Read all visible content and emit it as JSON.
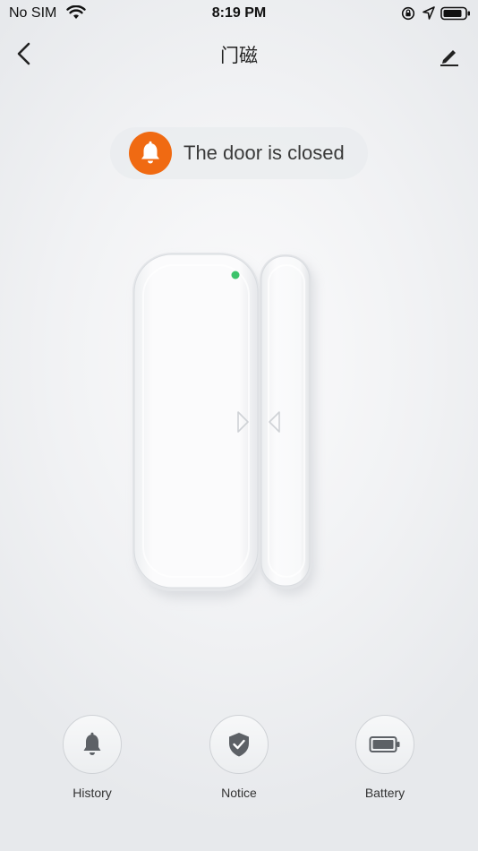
{
  "status_bar": {
    "carrier": "No SIM",
    "time": "8:19 PM"
  },
  "nav": {
    "title": "门磁"
  },
  "status": {
    "text": "The door is closed",
    "accent_color": "#f06a12"
  },
  "device": {
    "indicator_color": "#3cc36b"
  },
  "actions": [
    {
      "label": "History",
      "icon": "bell-icon"
    },
    {
      "label": "Notice",
      "icon": "shield-check-icon"
    },
    {
      "label": "Battery",
      "icon": "battery-icon"
    }
  ]
}
